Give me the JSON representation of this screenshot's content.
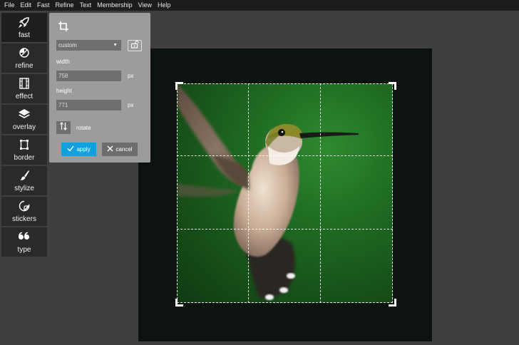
{
  "menu": [
    "File",
    "Edit",
    "Fast",
    "Refine",
    "Text",
    "Membership",
    "View",
    "Help"
  ],
  "sidebar": {
    "items": [
      {
        "label": "fast",
        "icon": "rocket-icon"
      },
      {
        "label": "refine",
        "icon": "refine-icon"
      },
      {
        "label": "effect",
        "icon": "film-icon"
      },
      {
        "label": "overlay",
        "icon": "layers-icon"
      },
      {
        "label": "border",
        "icon": "border-icon"
      },
      {
        "label": "stylize",
        "icon": "brush-icon"
      },
      {
        "label": "stickers",
        "icon": "sticker-icon"
      },
      {
        "label": "type",
        "icon": "quote-icon"
      }
    ]
  },
  "crop_panel": {
    "icon": "crop-icon",
    "aspect_select": "custom",
    "width_label": "width",
    "width_value": "758",
    "width_unit": "px",
    "height_label": "height",
    "height_value": "771",
    "height_unit": "px",
    "rotate_label": "rotate",
    "apply_label": "apply",
    "cancel_label": "cancel"
  },
  "colors": {
    "apply": "#12a0e0",
    "panel": "#9c9c9c",
    "menubar": "#1c1c1c",
    "background": "#3f3f3f"
  }
}
